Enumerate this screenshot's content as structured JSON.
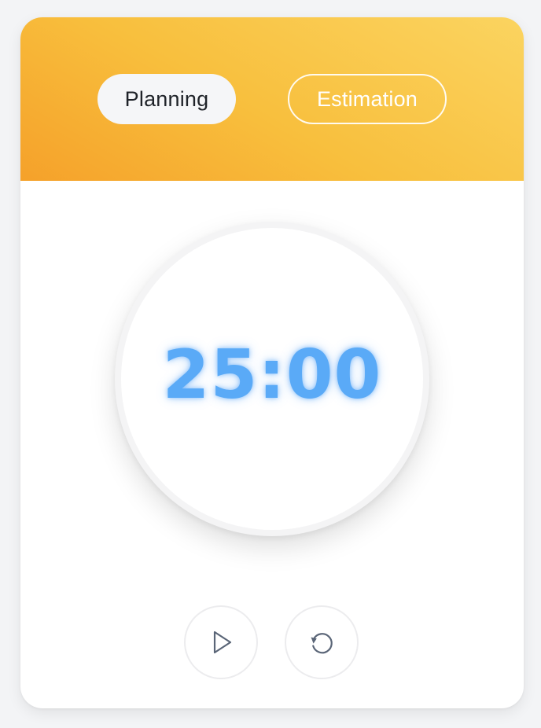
{
  "tabs": {
    "active_label": "Planning",
    "inactive_label": "Estimation"
  },
  "timer": {
    "display": "25:00"
  },
  "controls": {
    "play_icon": "play-icon",
    "reset_icon": "reset-icon"
  },
  "colors": {
    "header_gradient_start": "#f5a12a",
    "header_gradient_end": "#fbd460",
    "timer_text": "#5aaaf7",
    "icon_stroke": "#5a6577"
  }
}
